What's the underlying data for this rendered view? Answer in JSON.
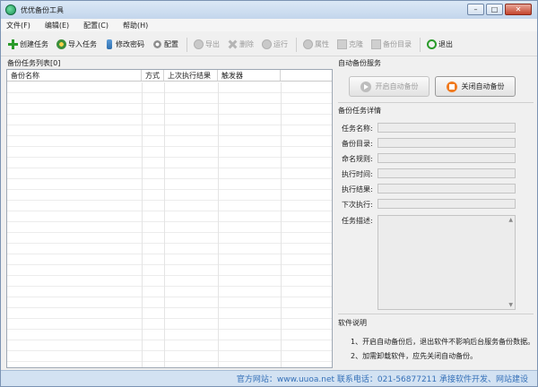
{
  "window": {
    "title": "优优备份工具",
    "controls": [
      "minimize-icon",
      "maximize-icon",
      "close-icon"
    ]
  },
  "menu": [
    "文件(F)",
    "编辑(E)",
    "配置(C)",
    "帮助(H)"
  ],
  "toolbar": [
    {
      "label": "创建任务",
      "icon": "plus-icon",
      "enabled": true
    },
    {
      "label": "导入任务",
      "icon": "import-icon",
      "enabled": true
    },
    {
      "label": "修改密码",
      "icon": "key-icon",
      "enabled": true
    },
    {
      "label": "配置",
      "icon": "gear-icon",
      "enabled": true
    },
    {
      "label": "导出",
      "icon": "export-icon",
      "enabled": false
    },
    {
      "label": "删除",
      "icon": "delete-icon",
      "enabled": false
    },
    {
      "label": "运行",
      "icon": "run-icon",
      "enabled": false
    },
    {
      "label": "属性",
      "icon": "properties-icon",
      "enabled": false
    },
    {
      "label": "克隆",
      "icon": "clone-icon",
      "enabled": false
    },
    {
      "label": "备份目录",
      "icon": "folder-icon",
      "enabled": false
    },
    {
      "label": "退出",
      "icon": "exit-icon",
      "enabled": true
    }
  ],
  "task_list": {
    "title": "备份任务列表[0]",
    "columns": [
      "备份名称",
      "方式",
      "上次执行结果",
      "触发器"
    ],
    "rows": []
  },
  "auto_service": {
    "title": "自动备份服务",
    "start_label": "开启自动备份",
    "stop_label": "关闭自动备份"
  },
  "details": {
    "title": "备份任务详情",
    "fields": [
      {
        "label": "任务名称:",
        "value": ""
      },
      {
        "label": "备份目录:",
        "value": ""
      },
      {
        "label": "命名规则:",
        "value": ""
      },
      {
        "label": "执行时间:",
        "value": ""
      },
      {
        "label": "执行结果:",
        "value": ""
      },
      {
        "label": "下次执行:",
        "value": ""
      }
    ],
    "desc_label": "任务描述:",
    "desc_value": ""
  },
  "notes": {
    "title": "软件说明",
    "items": [
      "1、开启自动备份后，退出软件不影响后台服务备份数据。",
      "2、加需卸载软件，应先关闭自动备份。"
    ]
  },
  "footer": {
    "text": "官方网站：www.uuoa.net 联系电话：021-56877211 承接软件开发、网站建设"
  },
  "colors": {
    "accent_link": "#3470b8",
    "stop_button_icon": "#f07a1f",
    "add_icon": "#2a9b2a"
  }
}
